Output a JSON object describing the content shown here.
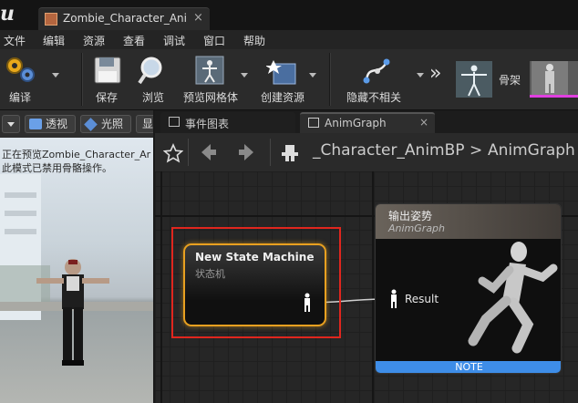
{
  "window": {
    "doc_tab_label": "Zombie_Character_AnimBP",
    "close_glyph": "×"
  },
  "menu": [
    "文件",
    "编辑",
    "资源",
    "查看",
    "调试",
    "窗口",
    "帮助"
  ],
  "toolbar": {
    "compile": "编译",
    "save": "保存",
    "browse": "浏览",
    "preview_mesh": "预览网格体",
    "create_asset": "创建资源",
    "hide_unrelated": "隐藏不相关",
    "skeleton": "骨架",
    "more_glyph": "»"
  },
  "viewport": {
    "perspective": "透视",
    "lit": "光照",
    "show": "显",
    "message_line1": "正在预览Zombie_Character_Ar",
    "message_line2": "此模式已禁用骨骼操作。"
  },
  "graph": {
    "tab_event_graph": "事件图表",
    "tab_anim_graph": "AnimGraph",
    "breadcrumb_parent": "_Character_AnimBP",
    "breadcrumb_sep": ">",
    "breadcrumb_current": "AnimGraph",
    "state_machine_title": "New State Machine",
    "state_machine_subtitle": "状态机",
    "output_title": "输出姿势",
    "output_subtitle": "AnimGraph",
    "result_pin": "Result",
    "note": "NOTE"
  },
  "colors": {
    "accent_orange": "#e8a020",
    "highlight_red": "#e0261e",
    "note_blue": "#3e8de8"
  },
  "icons": [
    "unreal-logo-icon",
    "blueprint-icon",
    "gear-icon",
    "save-icon",
    "magnifier-icon",
    "skeletal-mesh-icon",
    "create-asset-icon",
    "hide-unrelated-icon",
    "skeleton-icon",
    "mesh-icon",
    "star-icon",
    "back-arrow-icon",
    "forward-arrow-icon",
    "pose-icon"
  ]
}
